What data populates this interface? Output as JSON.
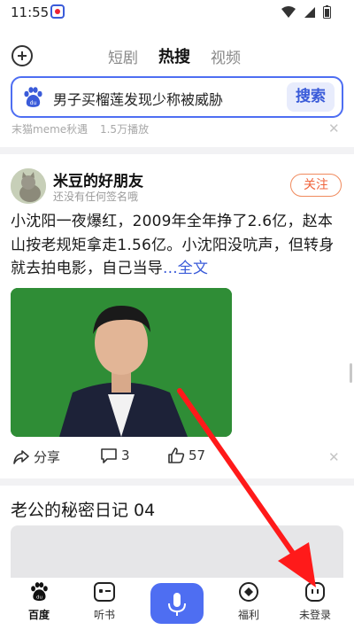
{
  "status": {
    "time": "11:55"
  },
  "tabs": [
    {
      "label": "短剧",
      "active": false
    },
    {
      "label": "热搜",
      "active": true
    },
    {
      "label": "视频",
      "active": false
    }
  ],
  "search": {
    "query": "男子买榴莲发现少称被威胁",
    "button": "搜索"
  },
  "suggest": {
    "source": "末猫meme秋遇",
    "views": "1.5万播放"
  },
  "post": {
    "author": "米豆的好朋友",
    "bio": "还没有任何签名哦",
    "follow": "关注",
    "text": "小沈阳一夜爆红，2009年全年挣了2.6亿，赵本山按老规矩拿走1.56亿。小沈阳没吭声，但转身就去拍电影，自己当导",
    "more": "...全文",
    "share": "分享",
    "comments": "3",
    "likes": "57"
  },
  "next_article": {
    "title": "老公的秘密日记 04"
  },
  "bottom_nav": {
    "home": "百度",
    "listen": "听书",
    "welfare": "福利",
    "profile": "未登录"
  },
  "colors": {
    "accent": "#4e6ef2",
    "follow": "#f0643c",
    "arrow": "#ff1a1a"
  }
}
